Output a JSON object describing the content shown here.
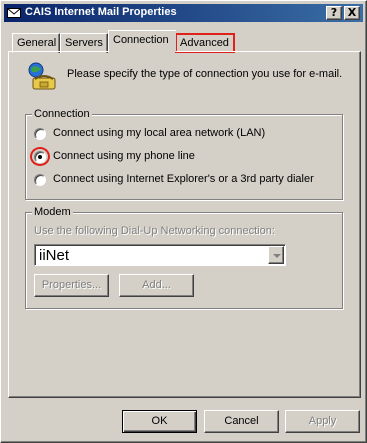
{
  "window": {
    "title": "CAIS Internet Mail Properties",
    "help_label": "?",
    "close_label": "X"
  },
  "tabs": [
    {
      "label": "General",
      "selected": false
    },
    {
      "label": "Servers",
      "selected": false
    },
    {
      "label": "Connection",
      "selected": true
    },
    {
      "label": "Advanced",
      "selected": false,
      "highlighted": true
    }
  ],
  "intro": {
    "icon": "phone-computer-icon",
    "text": "Please specify the type of connection you use for e-mail."
  },
  "connection": {
    "group_label": "Connection",
    "options": [
      {
        "label": "Connect using my local area network (LAN)",
        "selected": false
      },
      {
        "label": "Connect using my phone line",
        "selected": true
      },
      {
        "label": "Connect using Internet Explorer's or a 3rd party dialer",
        "selected": false
      }
    ]
  },
  "modem": {
    "group_label": "Modem",
    "dialup_label": "Use the following Dial-Up Networking connection:",
    "selected_connection": "iiNet",
    "properties_label": "Properties...",
    "add_label": "Add..."
  },
  "buttons": {
    "ok": "OK",
    "cancel": "Cancel",
    "apply": "Apply"
  },
  "colors": {
    "face": "#d4d0c8",
    "title_start": "#0a246a",
    "title_end": "#3a6ea5",
    "highlight_red": "#e0201a"
  }
}
